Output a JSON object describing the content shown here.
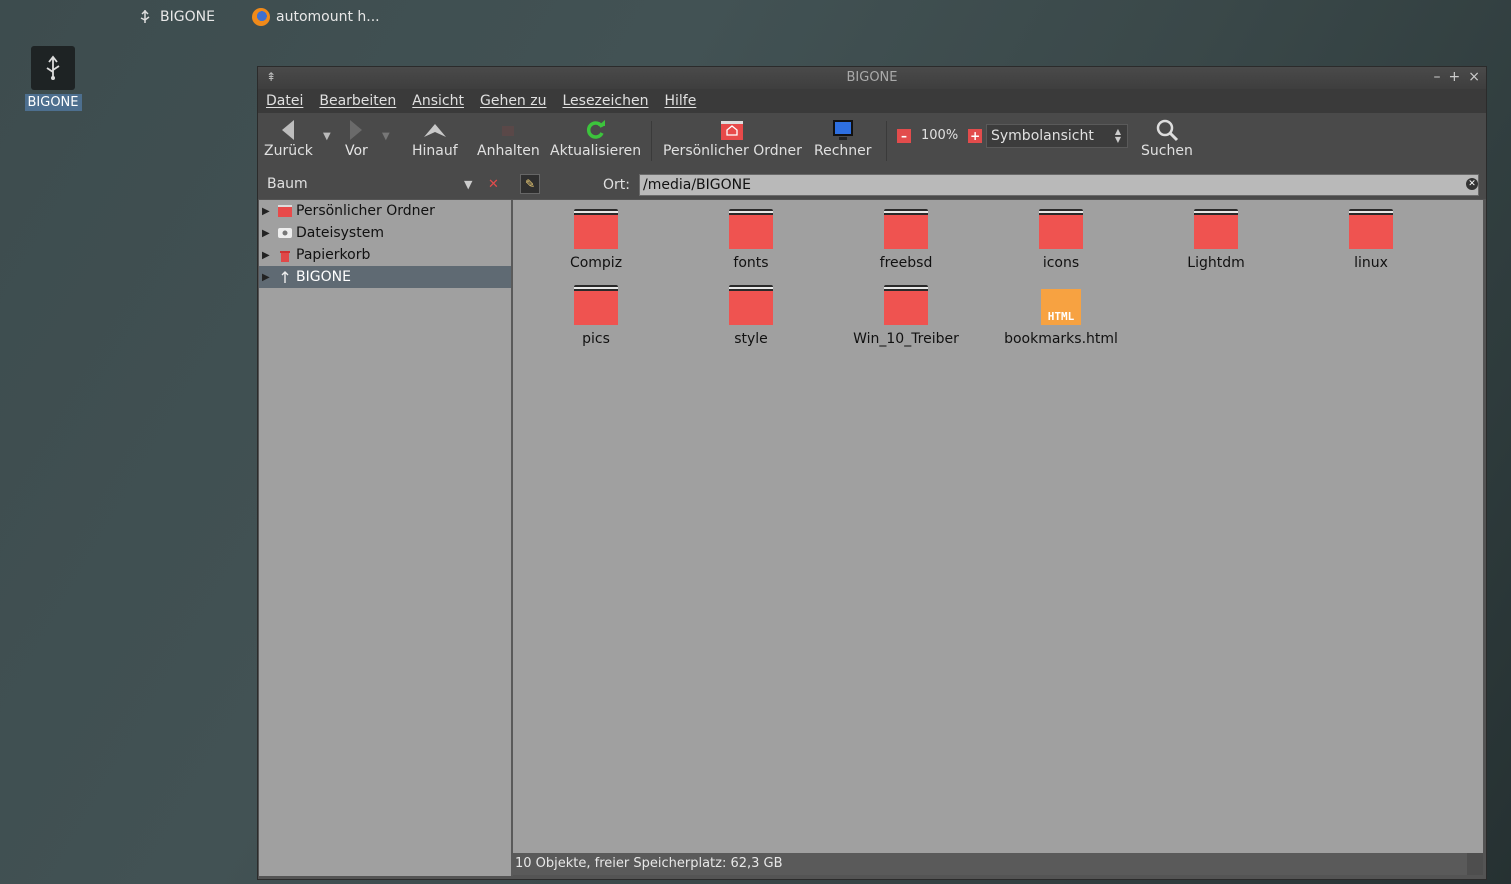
{
  "taskbar": {
    "items": [
      {
        "label": "BIGONE",
        "icon": "usb-icon"
      },
      {
        "label": "automount h...",
        "icon": "firefox-icon"
      }
    ]
  },
  "desktop": {
    "icon_label": "BIGONE"
  },
  "window": {
    "title": "BIGONE",
    "controls": [
      "–",
      "+",
      "×"
    ]
  },
  "menu": [
    "Datei",
    "Bearbeiten",
    "Ansicht",
    "Gehen zu",
    "Lesezeichen",
    "Hilfe"
  ],
  "toolbar": {
    "back": "Zurück",
    "forward": "Vor",
    "up": "Hinauf",
    "stop": "Anhalten",
    "reload": "Aktualisieren",
    "home": "Persönlicher Ordner",
    "computer": "Rechner",
    "zoom": "100%",
    "view": "Symbolansicht",
    "search": "Suchen"
  },
  "location": {
    "sidebar_mode": "Baum",
    "label": "Ort:",
    "path": "/media/BIGONE"
  },
  "sidebar": {
    "items": [
      {
        "label": "Persönlicher Ordner",
        "icon": "home-icon",
        "selected": false
      },
      {
        "label": "Dateisystem",
        "icon": "drive-icon",
        "selected": false
      },
      {
        "label": "Papierkorb",
        "icon": "trash-icon",
        "selected": false
      },
      {
        "label": "BIGONE",
        "icon": "usb-icon",
        "selected": true
      }
    ]
  },
  "files": [
    {
      "name": "Compiz",
      "type": "folder"
    },
    {
      "name": "fonts",
      "type": "folder"
    },
    {
      "name": "freebsd",
      "type": "folder"
    },
    {
      "name": "icons",
      "type": "folder"
    },
    {
      "name": "Lightdm",
      "type": "folder"
    },
    {
      "name": "linux",
      "type": "folder"
    },
    {
      "name": "pics",
      "type": "folder"
    },
    {
      "name": "style",
      "type": "folder"
    },
    {
      "name": "Win_10_Treiber",
      "type": "folder"
    },
    {
      "name": "bookmarks.html",
      "type": "html",
      "badge": "HTML"
    }
  ],
  "status": "10 Objekte, freier Speicherplatz: 62,3 GB",
  "colors": {
    "folder": "#ef5350",
    "selection": "#5f6a73",
    "accent_red": "#e24c4c"
  }
}
